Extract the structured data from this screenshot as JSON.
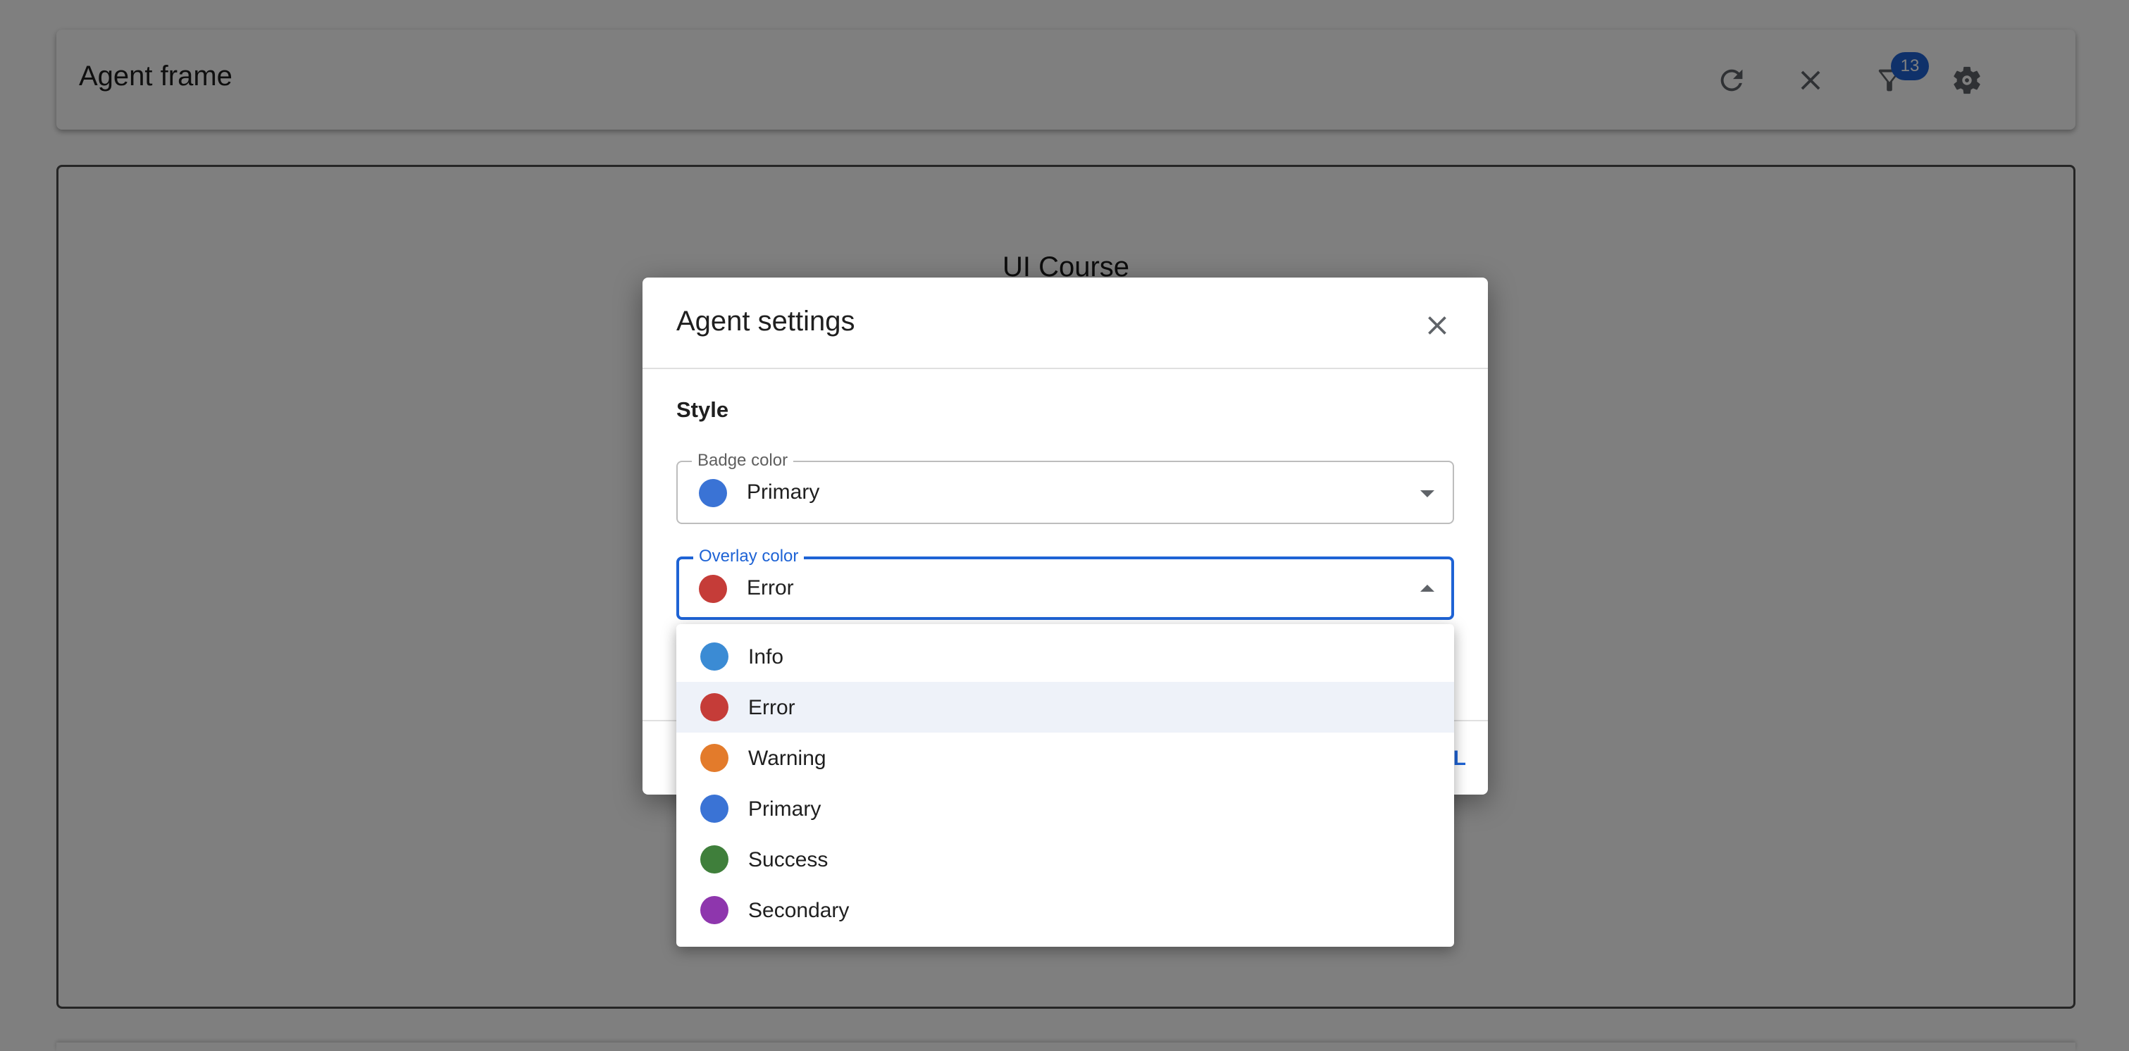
{
  "app": {
    "title": "Agent frame",
    "badge_count": "13",
    "icons": [
      "refresh-icon",
      "close-icon",
      "filter-icon",
      "gear-icon"
    ]
  },
  "frame": {
    "title": "UI Course"
  },
  "dialog": {
    "title": "Agent settings",
    "section": "Style",
    "badge_field": {
      "label": "Badge color",
      "value": "Primary",
      "color": "#3a73d5"
    },
    "overlay_field": {
      "label": "Overlay color",
      "value": "Error",
      "color": "#c53c38"
    },
    "action_label": "L"
  },
  "menu": {
    "items": [
      {
        "label": "Info",
        "color": "#3b8bd4",
        "selected": false
      },
      {
        "label": "Error",
        "color": "#c53c38",
        "selected": true
      },
      {
        "label": "Warning",
        "color": "#e37b2b",
        "selected": false
      },
      {
        "label": "Primary",
        "color": "#3a73d5",
        "selected": false
      },
      {
        "label": "Success",
        "color": "#3f7f3b",
        "selected": false
      },
      {
        "label": "Secondary",
        "color": "#8e36ad",
        "selected": false
      }
    ]
  }
}
